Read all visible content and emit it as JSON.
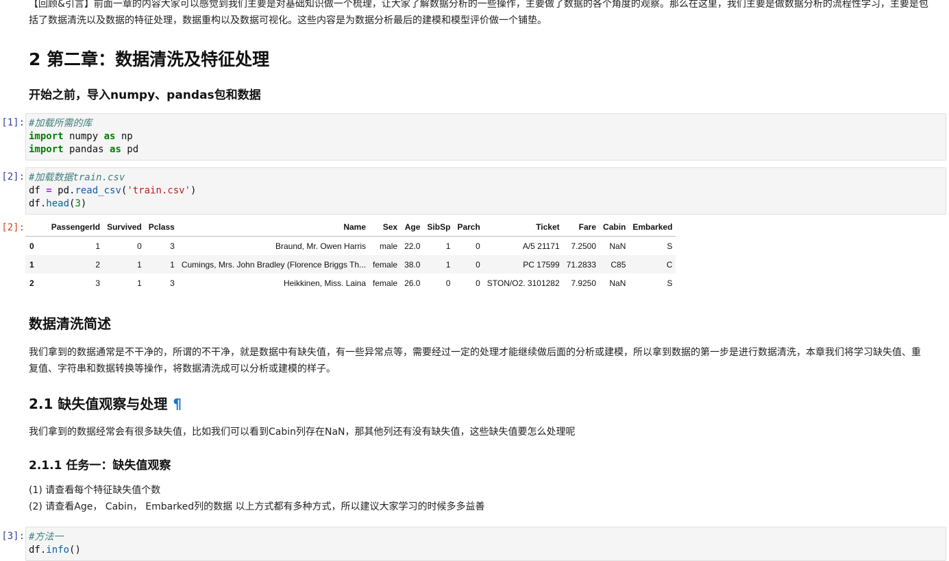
{
  "intro_text": "【回顾&引言】前面一章的内容大家可以感觉到我们主要是对基础知识做一个梳理，让大家了解数据分析的一些操作，主要做了数据的各个角度的观察。那么在这里，我们主要是做数据分析的流程性学习，主要是包括了数据清洗以及数据的特征处理，数据重构以及数据可视化。这些内容是为数据分析最后的建模和模型评价做一个铺垫。",
  "chapter_title": "2 第二章：数据清洗及特征处理",
  "before_start": "开始之前，导入numpy、pandas包和数据",
  "cells": [
    {
      "prompt": "[1]:",
      "lines": [
        "#加载所需的库",
        "import numpy as np",
        "import pandas as pd"
      ]
    },
    {
      "prompt": "[2]:",
      "lines": [
        "#加载数据train.csv",
        "df = pd.read_csv('train.csv')",
        "df.head(3)"
      ]
    },
    {
      "prompt": "[3]:",
      "lines": [
        "#方法一",
        "df.info()"
      ]
    }
  ],
  "output_prompt": "[2]:",
  "table": {
    "columns": [
      "",
      "PassengerId",
      "Survived",
      "Pclass",
      "Name",
      "Sex",
      "Age",
      "SibSp",
      "Parch",
      "Ticket",
      "Fare",
      "Cabin",
      "Embarked"
    ],
    "rows": [
      [
        "0",
        "1",
        "0",
        "3",
        "Braund, Mr. Owen Harris",
        "male",
        "22.0",
        "1",
        "0",
        "A/5 21171",
        "7.2500",
        "NaN",
        "S"
      ],
      [
        "1",
        "2",
        "1",
        "1",
        "Cumings, Mrs. John Bradley (Florence Briggs Th...",
        "female",
        "38.0",
        "1",
        "0",
        "PC 17599",
        "71.2833",
        "C85",
        "C"
      ],
      [
        "2",
        "3",
        "1",
        "3",
        "Heikkinen, Miss. Laina",
        "female",
        "26.0",
        "0",
        "0",
        "STON/O2. 3101282",
        "7.9250",
        "NaN",
        "S"
      ]
    ]
  },
  "cleaning_title": "数据清洗简述",
  "cleaning_text": "我们拿到的数据通常是不干净的，所谓的不干净，就是数据中有缺失值，有一些异常点等，需要经过一定的处理才能继续做后面的分析或建模，所以拿到数据的第一步是进行数据清洗，本章我们将学习缺失值、重复值、字符串和数据转换等操作，将数据清洗成可以分析或建模的样子。",
  "section_21_title": "2.1 缺失值观察与处理",
  "anchor_symbol": "¶",
  "section_21_text": "我们拿到的数据经常会有很多缺失值，比如我们可以看到Cabin列存在NaN，那其他列还有没有缺失值，这些缺失值要怎么处理呢",
  "task_title": "2.1.1 任务一：缺失值观察",
  "task_items": [
    "(1) 请查看每个特征缺失值个数",
    "(2) 请查看Age， Cabin， Embarked列的数据 以上方式都有多种方式，所以建议大家学习的时候多多益善"
  ]
}
